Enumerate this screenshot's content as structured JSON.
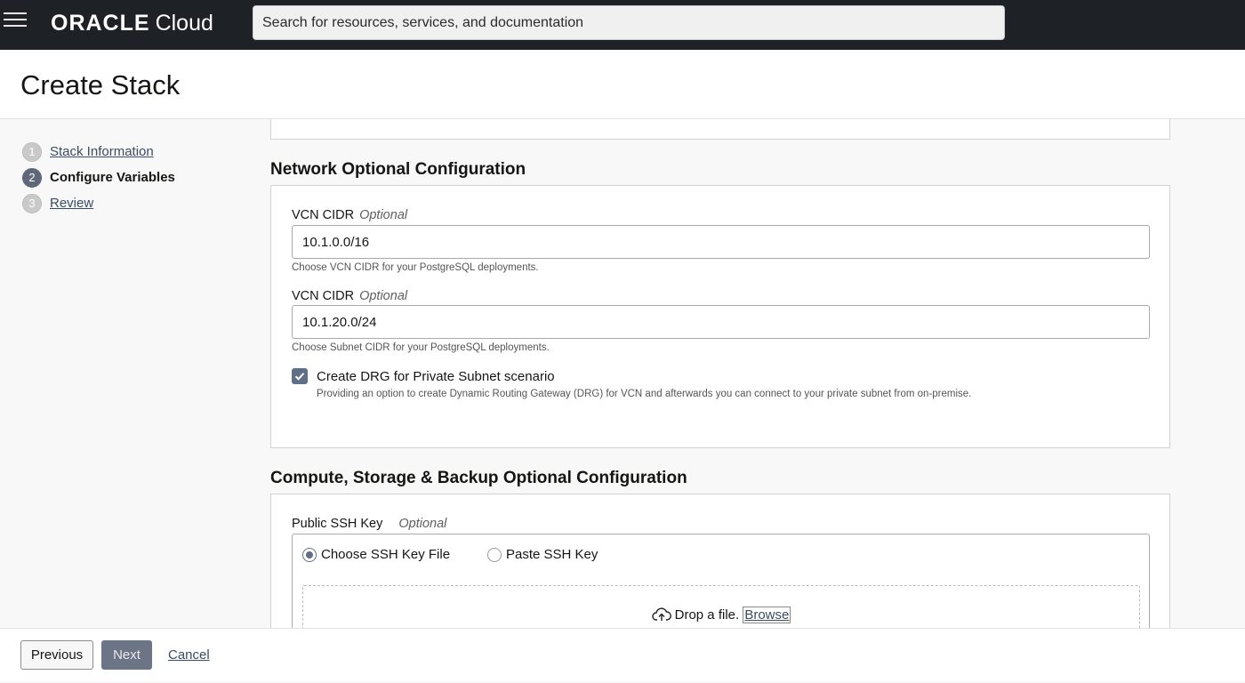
{
  "topbar": {
    "brand_oracle": "ORACLE",
    "brand_cloud": "Cloud",
    "search_placeholder": "Search for resources, services, and documentation"
  },
  "page": {
    "title": "Create Stack"
  },
  "steps": [
    {
      "number": "1",
      "label": "Stack Information",
      "state": "link"
    },
    {
      "number": "2",
      "label": "Configure Variables",
      "state": "active"
    },
    {
      "number": "3",
      "label": "Review",
      "state": "link"
    }
  ],
  "network": {
    "title": "Network Optional Configuration",
    "vcn_cidr": {
      "label": "VCN CIDR",
      "optional": "Optional",
      "value": "10.1.0.0/16",
      "help": "Choose VCN CIDR for your PostgreSQL deployments."
    },
    "subnet_cidr": {
      "label": "VCN CIDR",
      "optional": "Optional",
      "value": "10.1.20.0/24",
      "help": "Choose Subnet CIDR for your PostgreSQL deployments."
    },
    "drg": {
      "checked": true,
      "label": "Create DRG for Private Subnet scenario",
      "help": "Providing an option to create Dynamic Routing Gateway (DRG) for VCN and afterwards you can connect to your private subnet from on-premise."
    }
  },
  "compute": {
    "title": "Compute, Storage & Backup Optional Configuration",
    "ssh": {
      "label": "Public SSH Key",
      "optional": "Optional",
      "options": [
        "Choose SSH Key File",
        "Paste SSH Key"
      ],
      "selected": "Choose SSH Key File",
      "drop_text": "Drop a file.",
      "browse": "Browse"
    }
  },
  "footer": {
    "previous": "Previous",
    "next": "Next",
    "cancel": "Cancel"
  },
  "colors": {
    "topbar_bg": "#1e2227",
    "accent": "#5e6f86"
  }
}
